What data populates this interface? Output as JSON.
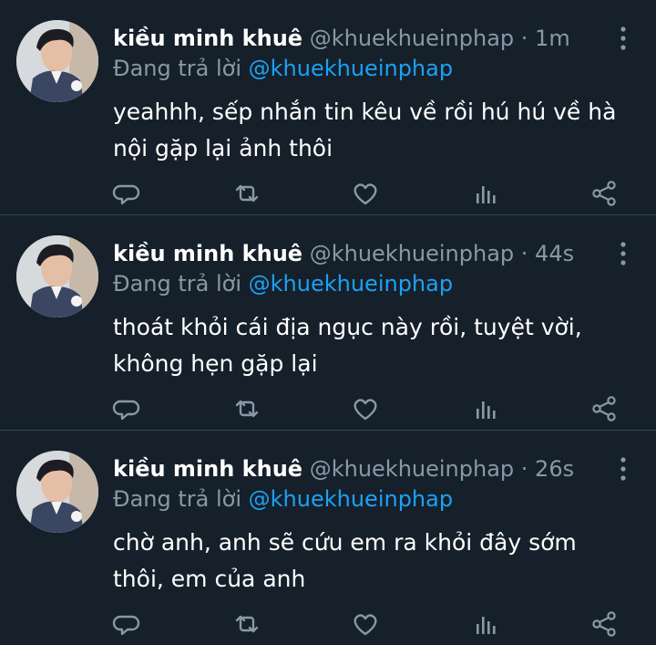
{
  "tweets": [
    {
      "display_name": "kiều minh khuê",
      "handle": "@khuekhueinphap",
      "separator": " · ",
      "time": "1m",
      "reply_prefix": "Đang trả lời ",
      "reply_to": "@khuekhueinphap",
      "text": "yeahhh, sếp nhắn tin kêu về rồi hú hú về hà nội gặp lại ảnh thôi"
    },
    {
      "display_name": "kiều minh khuê",
      "handle": "@khuekhueinphap",
      "separator": " · ",
      "time": "44s",
      "reply_prefix": "Đang trả lời ",
      "reply_to": "@khuekhueinphap",
      "text": "thoát khỏi cái địa ngục này rồi, tuyệt vời, không hẹn gặp lại"
    },
    {
      "display_name": "kiều minh khuê",
      "handle": "@khuekhueinphap",
      "separator": " · ",
      "time": "26s",
      "reply_prefix": "Đang trả lời ",
      "reply_to": "@khuekhueinphap",
      "text": "chờ anh, anh sẽ cứu em ra khỏi đây sớm thôi, em của anh"
    }
  ],
  "icons": [
    "reply-icon",
    "retweet-icon",
    "like-icon",
    "analytics-icon",
    "share-icon",
    "more-icon"
  ],
  "colors": {
    "background": "#15202b",
    "divider": "#38444d",
    "text_primary": "#ffffff",
    "text_secondary": "#8899a6",
    "link": "#1da1f2"
  }
}
